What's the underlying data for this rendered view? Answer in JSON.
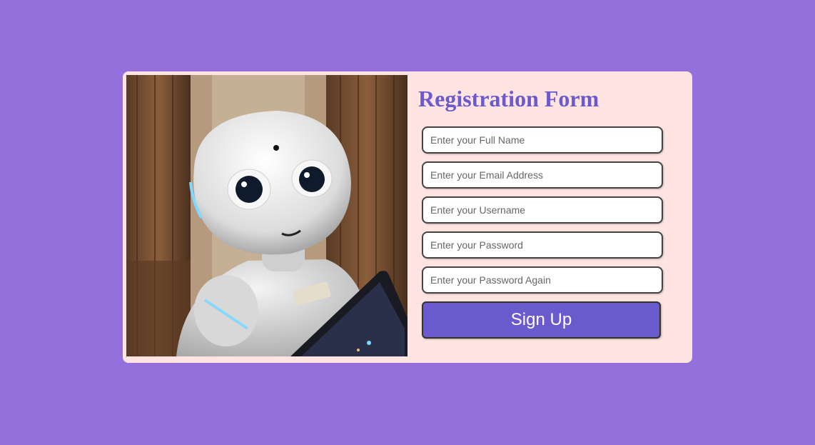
{
  "form": {
    "title": "Registration Form",
    "fields": [
      {
        "placeholder": "Enter your Full Name",
        "value": ""
      },
      {
        "placeholder": "Enter your Email Address",
        "value": ""
      },
      {
        "placeholder": "Enter your Username",
        "value": ""
      },
      {
        "placeholder": "Enter your Password",
        "value": ""
      },
      {
        "placeholder": "Enter your Password Again",
        "value": ""
      }
    ],
    "submit_label": "Sign Up"
  },
  "colors": {
    "background": "#9370db",
    "card": "#ffe4e1",
    "accent": "#6a5acd"
  },
  "image": {
    "subject": "robot-photo"
  }
}
